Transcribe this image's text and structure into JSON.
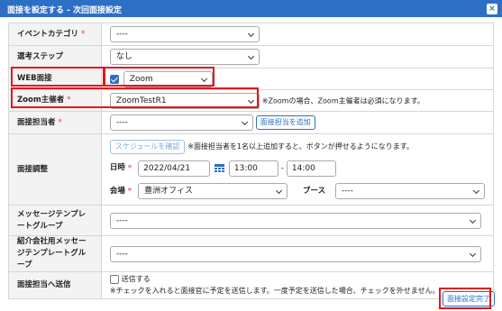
{
  "dialog": {
    "title": "面接を設定する - 次回面接設定",
    "close": "×"
  },
  "fields": {
    "event_category": {
      "label": "イベントカテゴリ",
      "req": "*",
      "value": "----"
    },
    "selection_step": {
      "label": "選考ステップ",
      "value": "なし"
    },
    "web_interview": {
      "label": "WEB面接",
      "checked": true,
      "value": "Zoom"
    },
    "zoom_host": {
      "label": "Zoom主催者",
      "req": "*",
      "value": "ZoomTestR1",
      "note": "※Zoomの場合、Zoom主催者は必須になります。"
    },
    "interviewer": {
      "label": "面接担当者",
      "req": "*",
      "value": "----",
      "add_button": "面接担当を追加"
    },
    "adjustment": {
      "label": "面接調整",
      "schedule_button": "スケジュールを確認",
      "schedule_note": "※面接担当者を1名以上追加すると、ボタンが押せるようになります。",
      "datetime_label": "日時",
      "req": "*",
      "date": "2022/04/21",
      "time_start": "13:00",
      "sep": "-",
      "time_end": "14:00",
      "venue_label": "会場",
      "venue": "豊洲オフィス",
      "booth_label": "ブース",
      "booth": "----"
    },
    "message_template": {
      "label": "メッセージテンプレートグループ",
      "value": "----"
    },
    "referral_template": {
      "label": "紹介会社用メッセージテンプレートグループ",
      "value": "----"
    },
    "send_to_interviewer": {
      "label": "面接担当へ送信",
      "checkbox_label": "送信する",
      "checked": false,
      "note": "※チェックを入れると面接官に予定を送信します。一度予定を送信した場合、チェックを外せません。"
    }
  },
  "footer": {
    "complete_button": "面接設定完了"
  },
  "colors": {
    "accent": "#2e6fc6",
    "highlight": "#e3171e",
    "required": "#e0325a"
  }
}
